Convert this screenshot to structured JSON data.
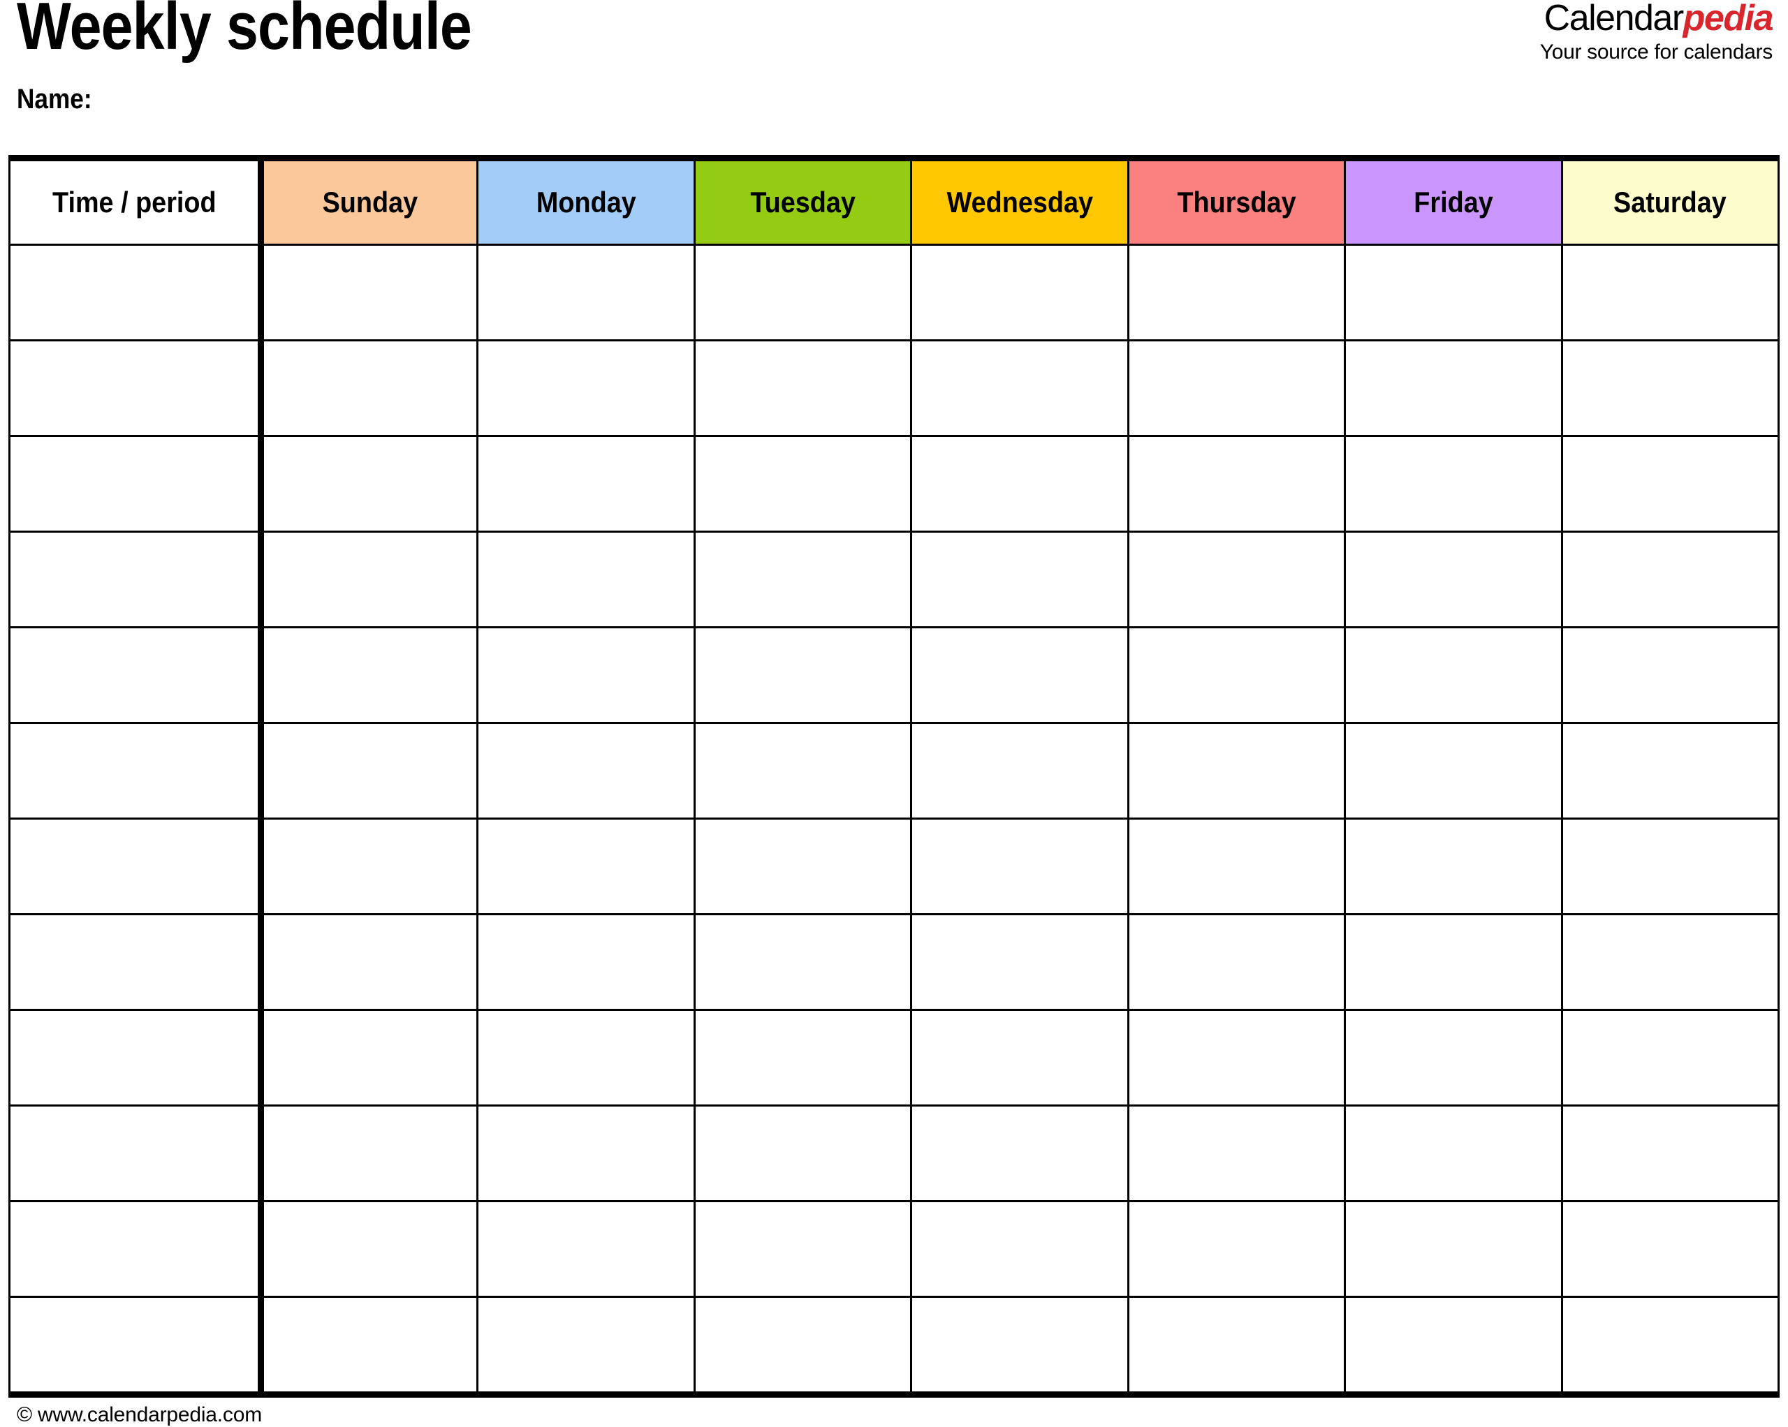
{
  "header": {
    "title": "Weekly schedule",
    "name_label": "Name:"
  },
  "brand": {
    "name_part1": "Calendar",
    "name_part2": "pedia",
    "tagline": "Your source for calendars",
    "accent_color": "#d8262c"
  },
  "table": {
    "columns": [
      {
        "label": "Time / period",
        "color": "#ffffff"
      },
      {
        "label": "Sunday",
        "color": "#fac89a"
      },
      {
        "label": "Monday",
        "color": "#a3ccf8"
      },
      {
        "label": "Tuesday",
        "color": "#93cc13"
      },
      {
        "label": "Wednesday",
        "color": "#ffc800"
      },
      {
        "label": "Thursday",
        "color": "#fb8080"
      },
      {
        "label": "Friday",
        "color": "#cb96fc"
      },
      {
        "label": "Saturday",
        "color": "#fcfccc"
      }
    ],
    "row_count": 12,
    "rows": [
      [
        "",
        "",
        "",
        "",
        "",
        "",
        "",
        ""
      ],
      [
        "",
        "",
        "",
        "",
        "",
        "",
        "",
        ""
      ],
      [
        "",
        "",
        "",
        "",
        "",
        "",
        "",
        ""
      ],
      [
        "",
        "",
        "",
        "",
        "",
        "",
        "",
        ""
      ],
      [
        "",
        "",
        "",
        "",
        "",
        "",
        "",
        ""
      ],
      [
        "",
        "",
        "",
        "",
        "",
        "",
        "",
        ""
      ],
      [
        "",
        "",
        "",
        "",
        "",
        "",
        "",
        ""
      ],
      [
        "",
        "",
        "",
        "",
        "",
        "",
        "",
        ""
      ],
      [
        "",
        "",
        "",
        "",
        "",
        "",
        "",
        ""
      ],
      [
        "",
        "",
        "",
        "",
        "",
        "",
        "",
        ""
      ],
      [
        "",
        "",
        "",
        "",
        "",
        "",
        "",
        ""
      ],
      [
        "",
        "",
        "",
        "",
        "",
        "",
        "",
        ""
      ]
    ]
  },
  "footer": {
    "copyright": "© www.calendarpedia.com"
  }
}
